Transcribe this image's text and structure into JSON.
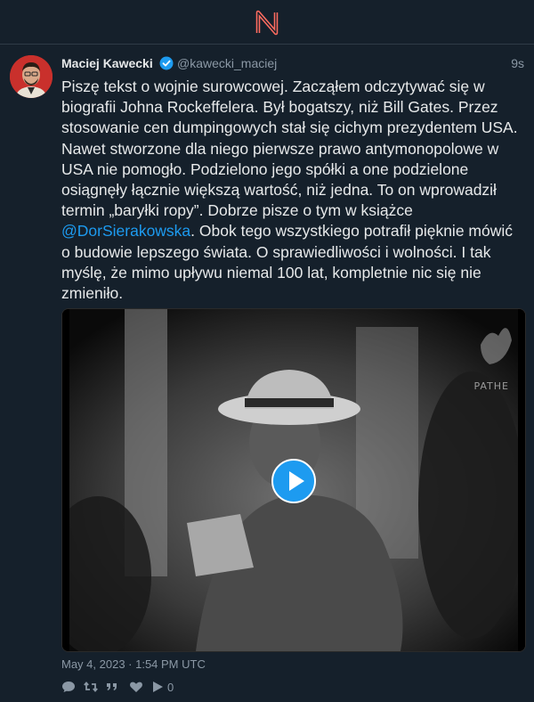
{
  "app": {
    "logo": "N"
  },
  "tweet": {
    "author_name": "Maciej Kawecki",
    "handle": "@kawecki_maciej",
    "time": "9s",
    "text_before": "Piszę tekst o wojnie surowcowej. Zacząłem odczytywać się w biografii Johna Rockeffelera. Był bogatszy, niż Bill Gates. Przez stosowanie cen dumpingowych stał się cichym prezydentem USA. Nawet stworzone dla niego pierwsze prawo antymonopolowe w USA nie pomogło. Podzielono jego spółki a one podzielone osiągnęły łącznie większą wartość, niż jedna. To on wprowadził termin „baryłki ropy”. Dobrze pisze o tym w książce ",
    "mention": "@DorSierakowska",
    "text_after": ". Obok tego wszystkiego potrafił pięknie mówić o budowie lepszego świata. O sprawiedliwości i wolności. I tak myślę, że mimo upływu niemal 100 lat, kompletnie nic się nie zmieniło.",
    "video_watermark": "PATHE",
    "date": "May 4, 2023 · 1:54 PM UTC",
    "play_count": "0"
  },
  "icons": {
    "verified": "verified-badge-icon",
    "reply": "comment-icon",
    "retweet": "retweet-icon",
    "quote": "quote-icon",
    "like": "heart-icon",
    "play": "play-icon"
  },
  "colors": {
    "background": "#15202b",
    "accent": "#1d9bf0",
    "logo": "#e0245e"
  }
}
